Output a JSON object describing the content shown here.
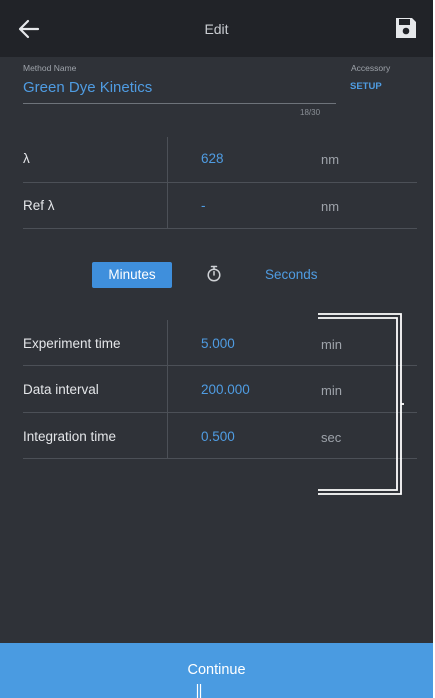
{
  "header": {
    "title": "Edit",
    "back_icon": "arrow-left-icon",
    "save_icon": "floppy-disk-icon"
  },
  "method": {
    "label": "Method Name",
    "value": "Green Dye Kinetics",
    "char_count": "18/30"
  },
  "accessory": {
    "label": "Accessory",
    "action": "SETUP"
  },
  "wavelengths": [
    {
      "label": "λ",
      "value": "628",
      "unit": "nm"
    },
    {
      "label": "Ref λ",
      "value": "-",
      "unit": "nm"
    }
  ],
  "time_unit": {
    "minutes": "Minutes",
    "seconds": "Seconds",
    "selected": "Minutes",
    "icon": "stopwatch-icon"
  },
  "timing": [
    {
      "label": "Experiment time",
      "value": "5.000",
      "unit": "min"
    },
    {
      "label": "Data interval",
      "value": "200.000",
      "unit": "min"
    },
    {
      "label": "Integration time",
      "value": "0.500",
      "unit": "sec"
    }
  ],
  "footer": {
    "continue_label": "Continue"
  },
  "colors": {
    "background": "#2f3238",
    "header": "#212328",
    "accent": "#4a9be1",
    "text": "#e4e6e9"
  }
}
